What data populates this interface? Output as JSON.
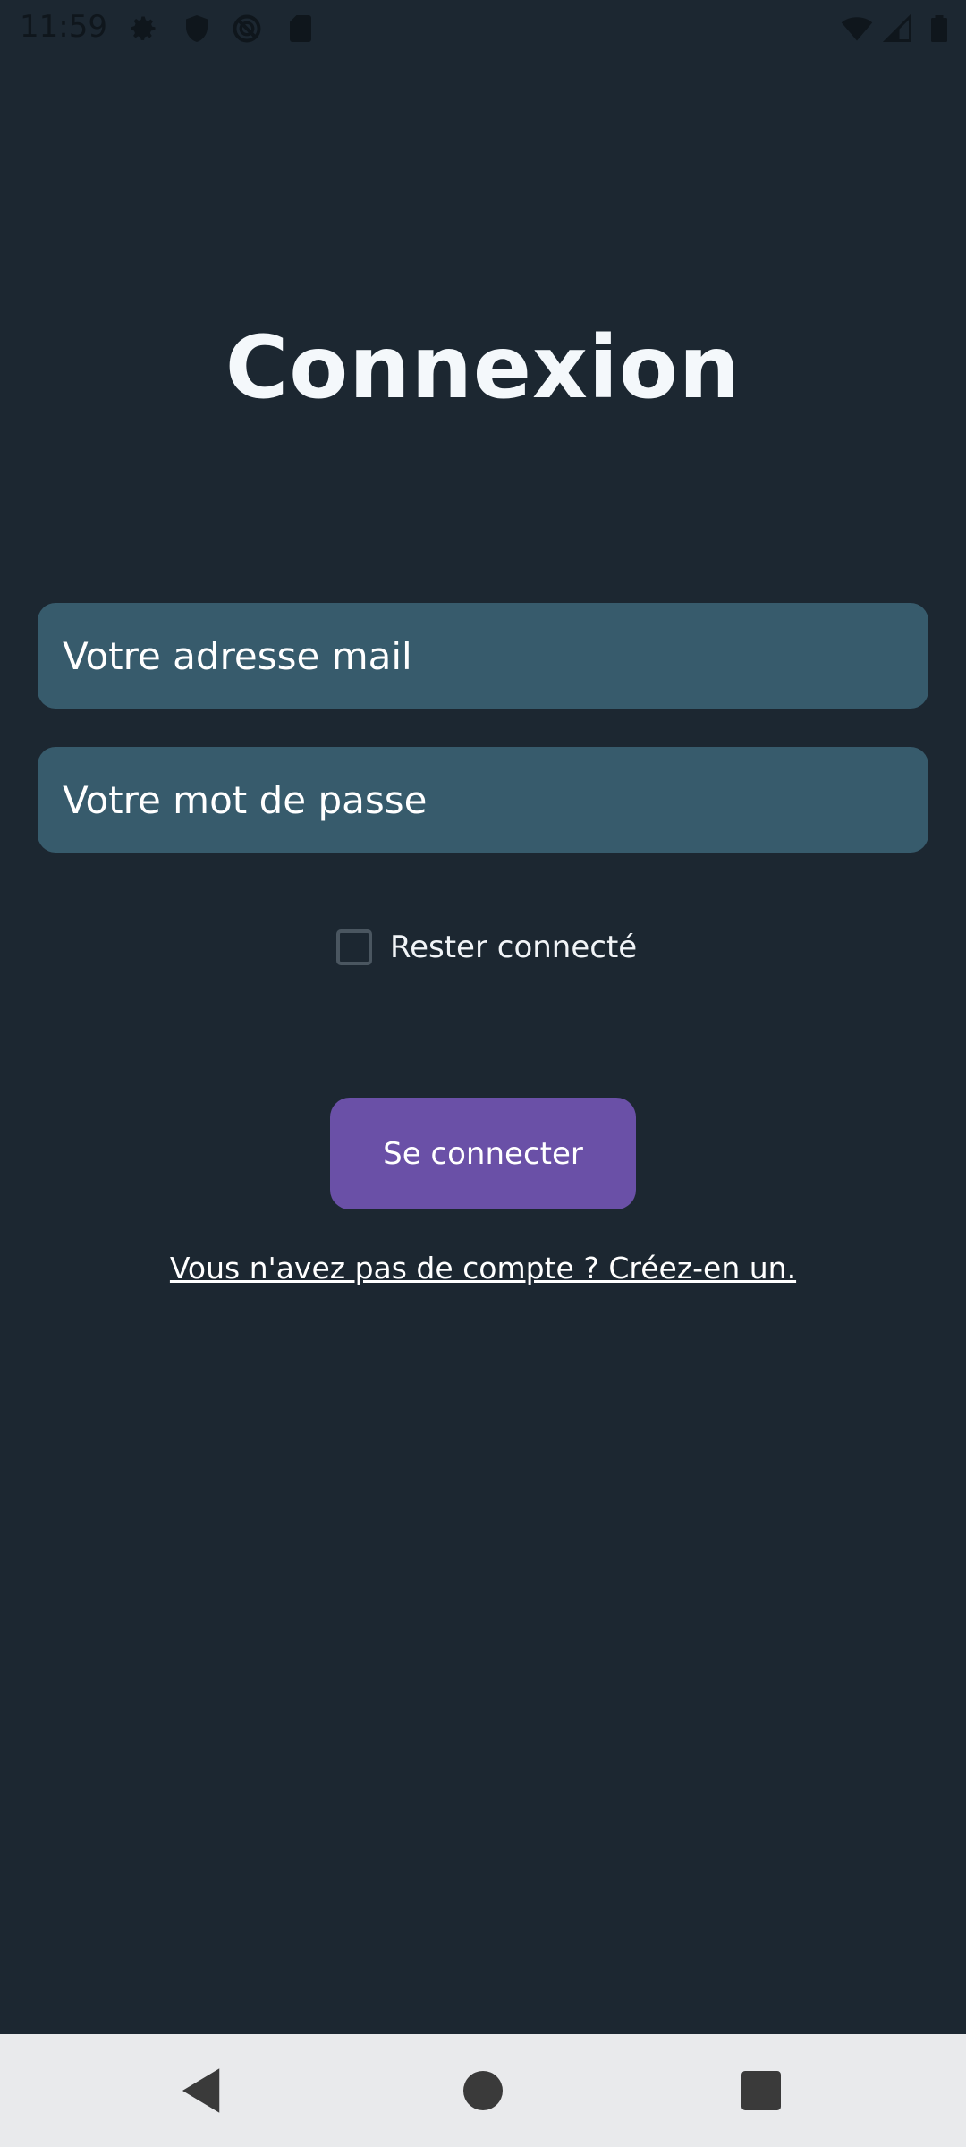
{
  "status_bar": {
    "time": "11:59",
    "icons": [
      "settings-icon",
      "shield-icon",
      "no-sync-icon",
      "sd-card-icon",
      "wifi-icon",
      "signal-icon",
      "battery-icon"
    ]
  },
  "login": {
    "title": "Connexion",
    "email_placeholder": "Votre adresse mail",
    "password_placeholder": "Votre mot de passe",
    "remember_label": "Rester connecté",
    "remember_checked": false,
    "submit_label": "Se connecter",
    "signup_link": "Vous n'avez pas de compte ? Créez-en un."
  },
  "nav_bar": {
    "buttons": [
      "back-icon",
      "home-icon",
      "recents-icon"
    ]
  },
  "colors": {
    "background": "#1c2731",
    "field": "#375b6c",
    "button": "#6a50a7",
    "nav_bar": "#e9eaec"
  }
}
